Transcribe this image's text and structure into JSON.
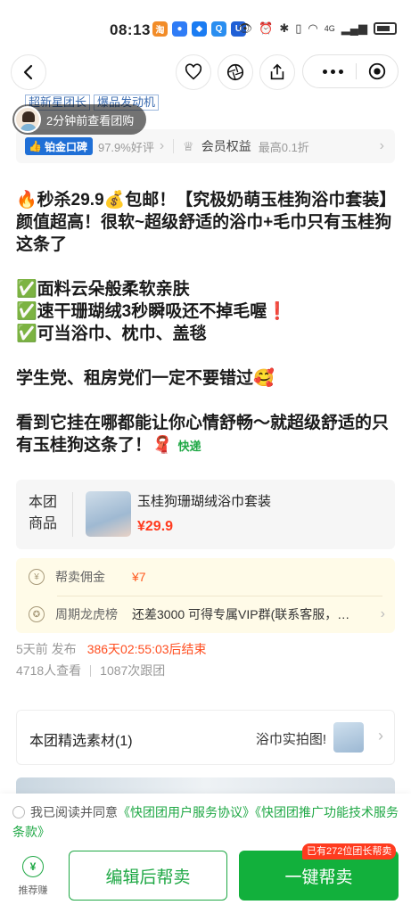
{
  "status_bar": {
    "time": "08:13",
    "network": "4G"
  },
  "nav": {
    "back_icon": "chevron-left-icon",
    "favorite_icon": "heart-icon",
    "share_icon": "aperture-icon",
    "export_icon": "share-icon",
    "more_icon": "more-dots-icon",
    "close_icon": "target-icon"
  },
  "header_tags": [
    "超新星团长",
    "爆品发动机"
  ],
  "viewer_toast": "2分钟前查看团购",
  "rating": {
    "badge": "铂金口碑",
    "good_rate": "97.9%好评",
    "member_label": "会员权益",
    "member_sub": "最高0.1折"
  },
  "description": {
    "line1": "🔥秒杀29.9💰包邮！【究极奶萌玉桂狗浴巾套装】",
    "line2": "颜值超高！很软~超级舒适的浴巾+毛巾只有玉桂狗这条了",
    "point1": "✅面料云朵般柔软亲肤",
    "point2": "✅速干珊瑚绒3秒瞬吸还不掉毛喔❗",
    "point3": "✅可当浴巾、枕巾、盖毯",
    "line3": "学生党、租房党们一定不要错过🥰",
    "line4": "看到它挂在哪都能让你心情舒畅～就超级舒适的只有玉桂狗这条了！🧣",
    "express_tag": "快递"
  },
  "product": {
    "label": "本团商品",
    "title": "玉桂狗珊瑚绒浴巾套装",
    "price": "¥29.9"
  },
  "commission": {
    "label": "帮卖佣金",
    "value": "¥7",
    "rank_label": "周期龙虎榜",
    "rank_value": "还差3000 可得专属VIP群(联系客服，…"
  },
  "meta": {
    "posted": "5天前 发布",
    "countdown": "386天02:55:03后结束",
    "views": "4718人查看",
    "joins": "1087次跟团"
  },
  "materials": {
    "title": "本团精选素材(1)",
    "subtitle": "浴巾实拍图!"
  },
  "footer": {
    "agree_prefix": "我已阅读并同意",
    "agree_link1": "《快团团用户服务协议》",
    "agree_link2": "《快团团推广功能技术服务条款》",
    "promo_label": "推荐赚",
    "edit_button": "编辑后帮卖",
    "oneclick_button": "一键帮卖",
    "hint_badge": "已有272位团长帮卖"
  },
  "colors": {
    "brand_green": "#12b03c",
    "price_red": "#ff3b1f",
    "commission_bg": "#fffbe8"
  }
}
